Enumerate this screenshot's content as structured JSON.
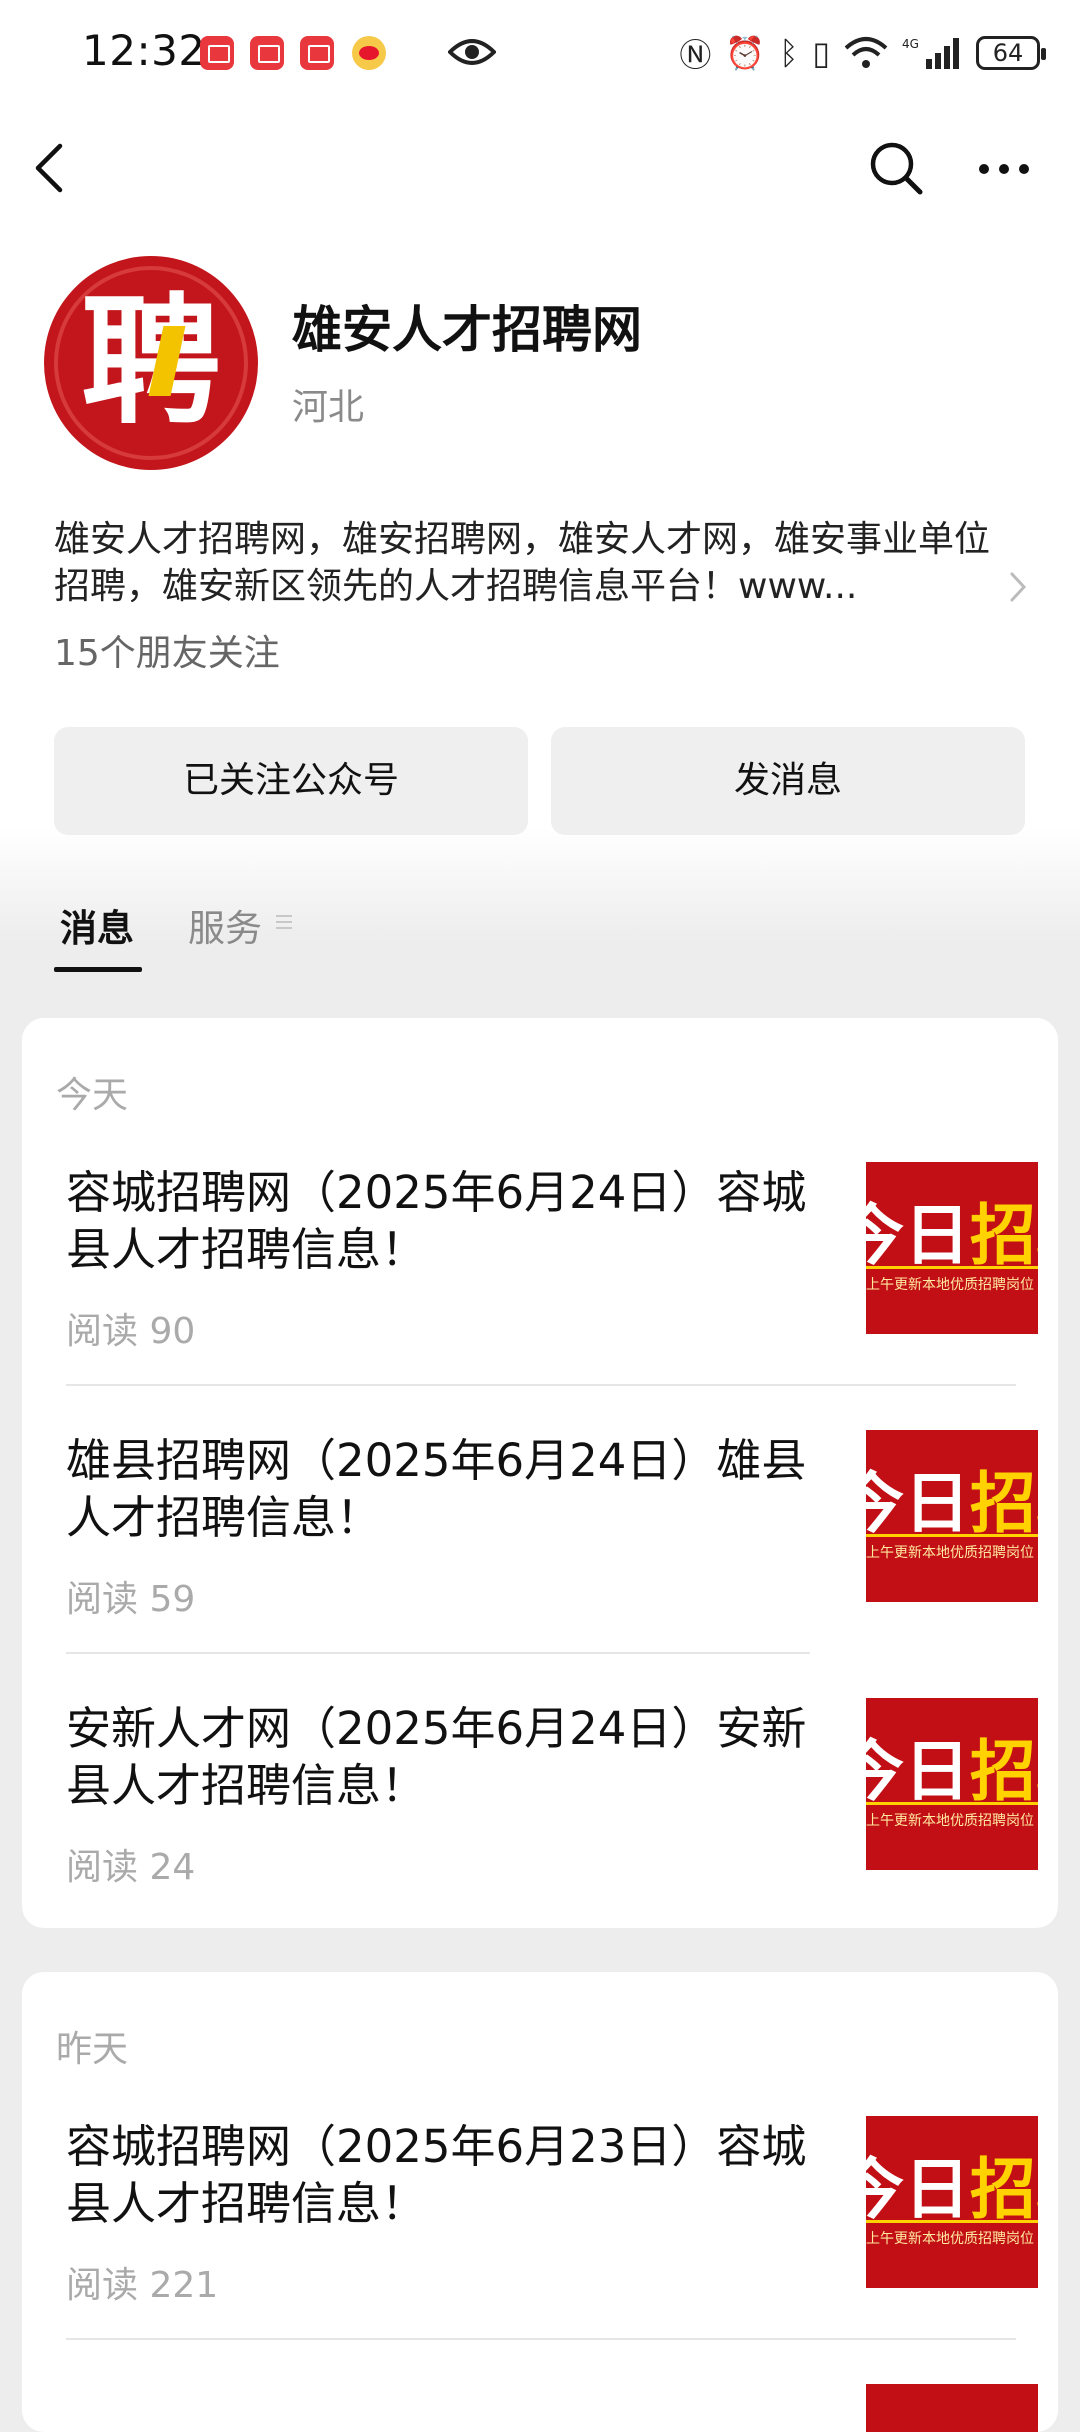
{
  "status_bar": {
    "time": "12:32",
    "battery": "64",
    "network": "4G",
    "icons": [
      "nfc-icon",
      "alarm-icon",
      "bluetooth-icon",
      "vibrate-icon",
      "wifi-icon",
      "signal-icon"
    ]
  },
  "nav": {
    "back_icon": "chevron-left-icon",
    "search_icon": "search-icon",
    "more_icon": "more-dots-icon"
  },
  "account": {
    "avatar_char": "聘",
    "name": "雄安人才招聘网",
    "region": "河北",
    "description": "雄安人才招聘网，雄安招聘网，雄安人才网，雄安事业单位招聘，雄安新区领先的人才招聘信息平台！www...",
    "friends_following": "15个朋友关注"
  },
  "actions": {
    "follow_label": "已关注公众号",
    "message_label": "发消息"
  },
  "tabs": [
    {
      "label": "消息",
      "active": true
    },
    {
      "label": "服务",
      "active": false
    }
  ],
  "feed": [
    {
      "day": "今天",
      "articles": [
        {
          "title": "容城招聘网（2025年6月24日）容城县人才招聘信息！",
          "reads": "阅读 90"
        },
        {
          "title": "雄县招聘网（2025年6月24日）雄县人才招聘信息！",
          "reads": "阅读 59"
        },
        {
          "title": "安新人才网（2025年6月24日）安新县人才招聘信息！",
          "reads": "阅读 24"
        }
      ]
    },
    {
      "day": "昨天",
      "articles": [
        {
          "title": "容城招聘网（2025年6月23日）容城县人才招聘信息！",
          "reads": "阅读 221"
        }
      ]
    }
  ],
  "thumbnail": {
    "headline_white": "今日",
    "headline_yellow": "招聘",
    "subtitle": "上午更新本地优质招聘岗位"
  },
  "colors": {
    "brand_red": "#c20f15",
    "accent_yellow": "#ffd200",
    "background": "#ededed"
  }
}
